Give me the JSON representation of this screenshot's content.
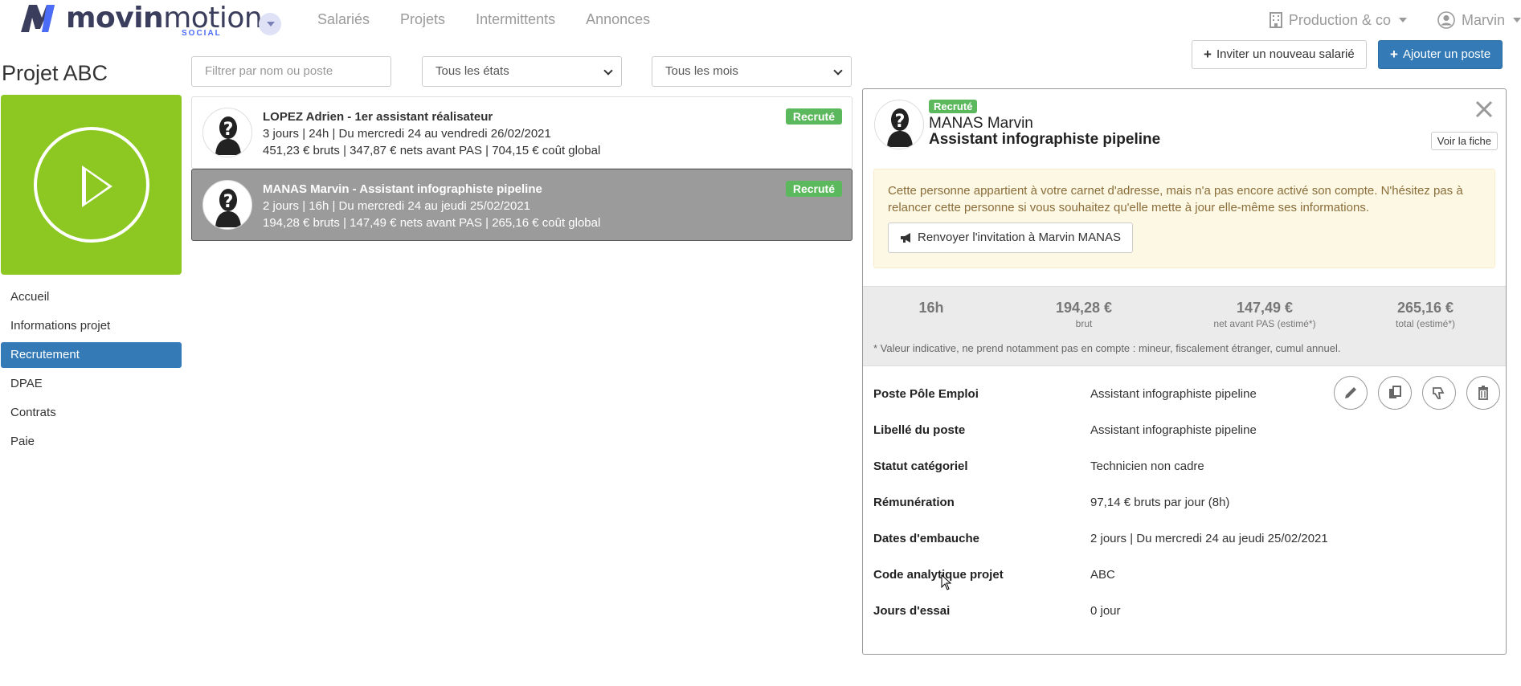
{
  "brand": {
    "name_bold": "movin",
    "name_light": "motion",
    "sub": "SOCIAL",
    "logo_glyph": "M",
    "accent": "#4a6cf7"
  },
  "nav": {
    "links": [
      "Salariés",
      "Projets",
      "Intermittents",
      "Annonces"
    ],
    "company": "Production & co",
    "user": "Marvin"
  },
  "project": {
    "title": "Projet ABC",
    "tile_color": "#8cc821"
  },
  "sidebar": {
    "items": [
      {
        "label": "Accueil",
        "active": false
      },
      {
        "label": "Informations projet",
        "active": false
      },
      {
        "label": "Recrutement",
        "active": true
      },
      {
        "label": "DPAE",
        "active": false
      },
      {
        "label": "Contrats",
        "active": false
      },
      {
        "label": "Paie",
        "active": false
      }
    ]
  },
  "filters": {
    "search_placeholder": "Filtrer par nom ou poste",
    "state_selected": "Tous les états",
    "month_selected": "Tous les mois"
  },
  "actions": {
    "invite_label": "Inviter un nouveau salarié",
    "add_label": "Ajouter un poste"
  },
  "list": [
    {
      "title": "LOPEZ Adrien - 1er assistant réalisateur",
      "line2": "3 jours | 24h | Du mercredi 24 au vendredi 26/02/2021",
      "line3": "451,23 € bruts | 347,87 € nets avant PAS | 704,15 € coût global",
      "badge": "Recruté",
      "selected": false
    },
    {
      "title": "MANAS Marvin - Assistant infographiste pipeline",
      "line2": "2 jours | 16h | Du mercredi 24 au jeudi 25/02/2021",
      "line3": "194,28 € bruts | 147,49 € nets avant PAS | 265,16 € coût global",
      "badge": "Recruté",
      "selected": true
    }
  ],
  "detail": {
    "badge": "Recruté",
    "name": "MANAS Marvin",
    "role": "Assistant infographiste pipeline",
    "voir_label": "Voir la fiche",
    "alert_text": "Cette personne appartient à votre carnet d'adresse, mais n'a pas encore activé son compte. N'hésitez pas à relancer cette personne si vous souhaitez qu'elle mette à jour elle-même ses informations.",
    "alert_button": "Renvoyer l'invitation à Marvin MANAS",
    "stats": [
      {
        "value": "16h",
        "label": ""
      },
      {
        "value": "194,28 €",
        "label": "brut"
      },
      {
        "value": "147,49 €",
        "label": "net avant PAS (estimé*)"
      },
      {
        "value": "265,16 €",
        "label": "total (estimé*)"
      }
    ],
    "stats_note": "* Valeur indicative, ne prend notamment pas en compte : mineur, fiscalement étranger, cumul annuel.",
    "fields": [
      {
        "key": "Poste Pôle Emploi",
        "value": "Assistant infographiste pipeline"
      },
      {
        "key": "Libellé du poste",
        "value": "Assistant infographiste pipeline"
      },
      {
        "key": "Statut catégoriel",
        "value": "Technicien non cadre"
      },
      {
        "key": "Rémunération",
        "value": "97,14 € bruts par jour (8h)"
      },
      {
        "key": "Dates d'embauche",
        "value": "2 jours | Du mercredi 24 au jeudi 25/02/2021"
      },
      {
        "key": "Code analytique projet",
        "value": "ABC"
      },
      {
        "key": "Jours d'essai",
        "value": "0 jour"
      }
    ],
    "row_actions": [
      "edit-icon",
      "duplicate-icon",
      "thumbs-down-icon",
      "trash-icon"
    ]
  }
}
